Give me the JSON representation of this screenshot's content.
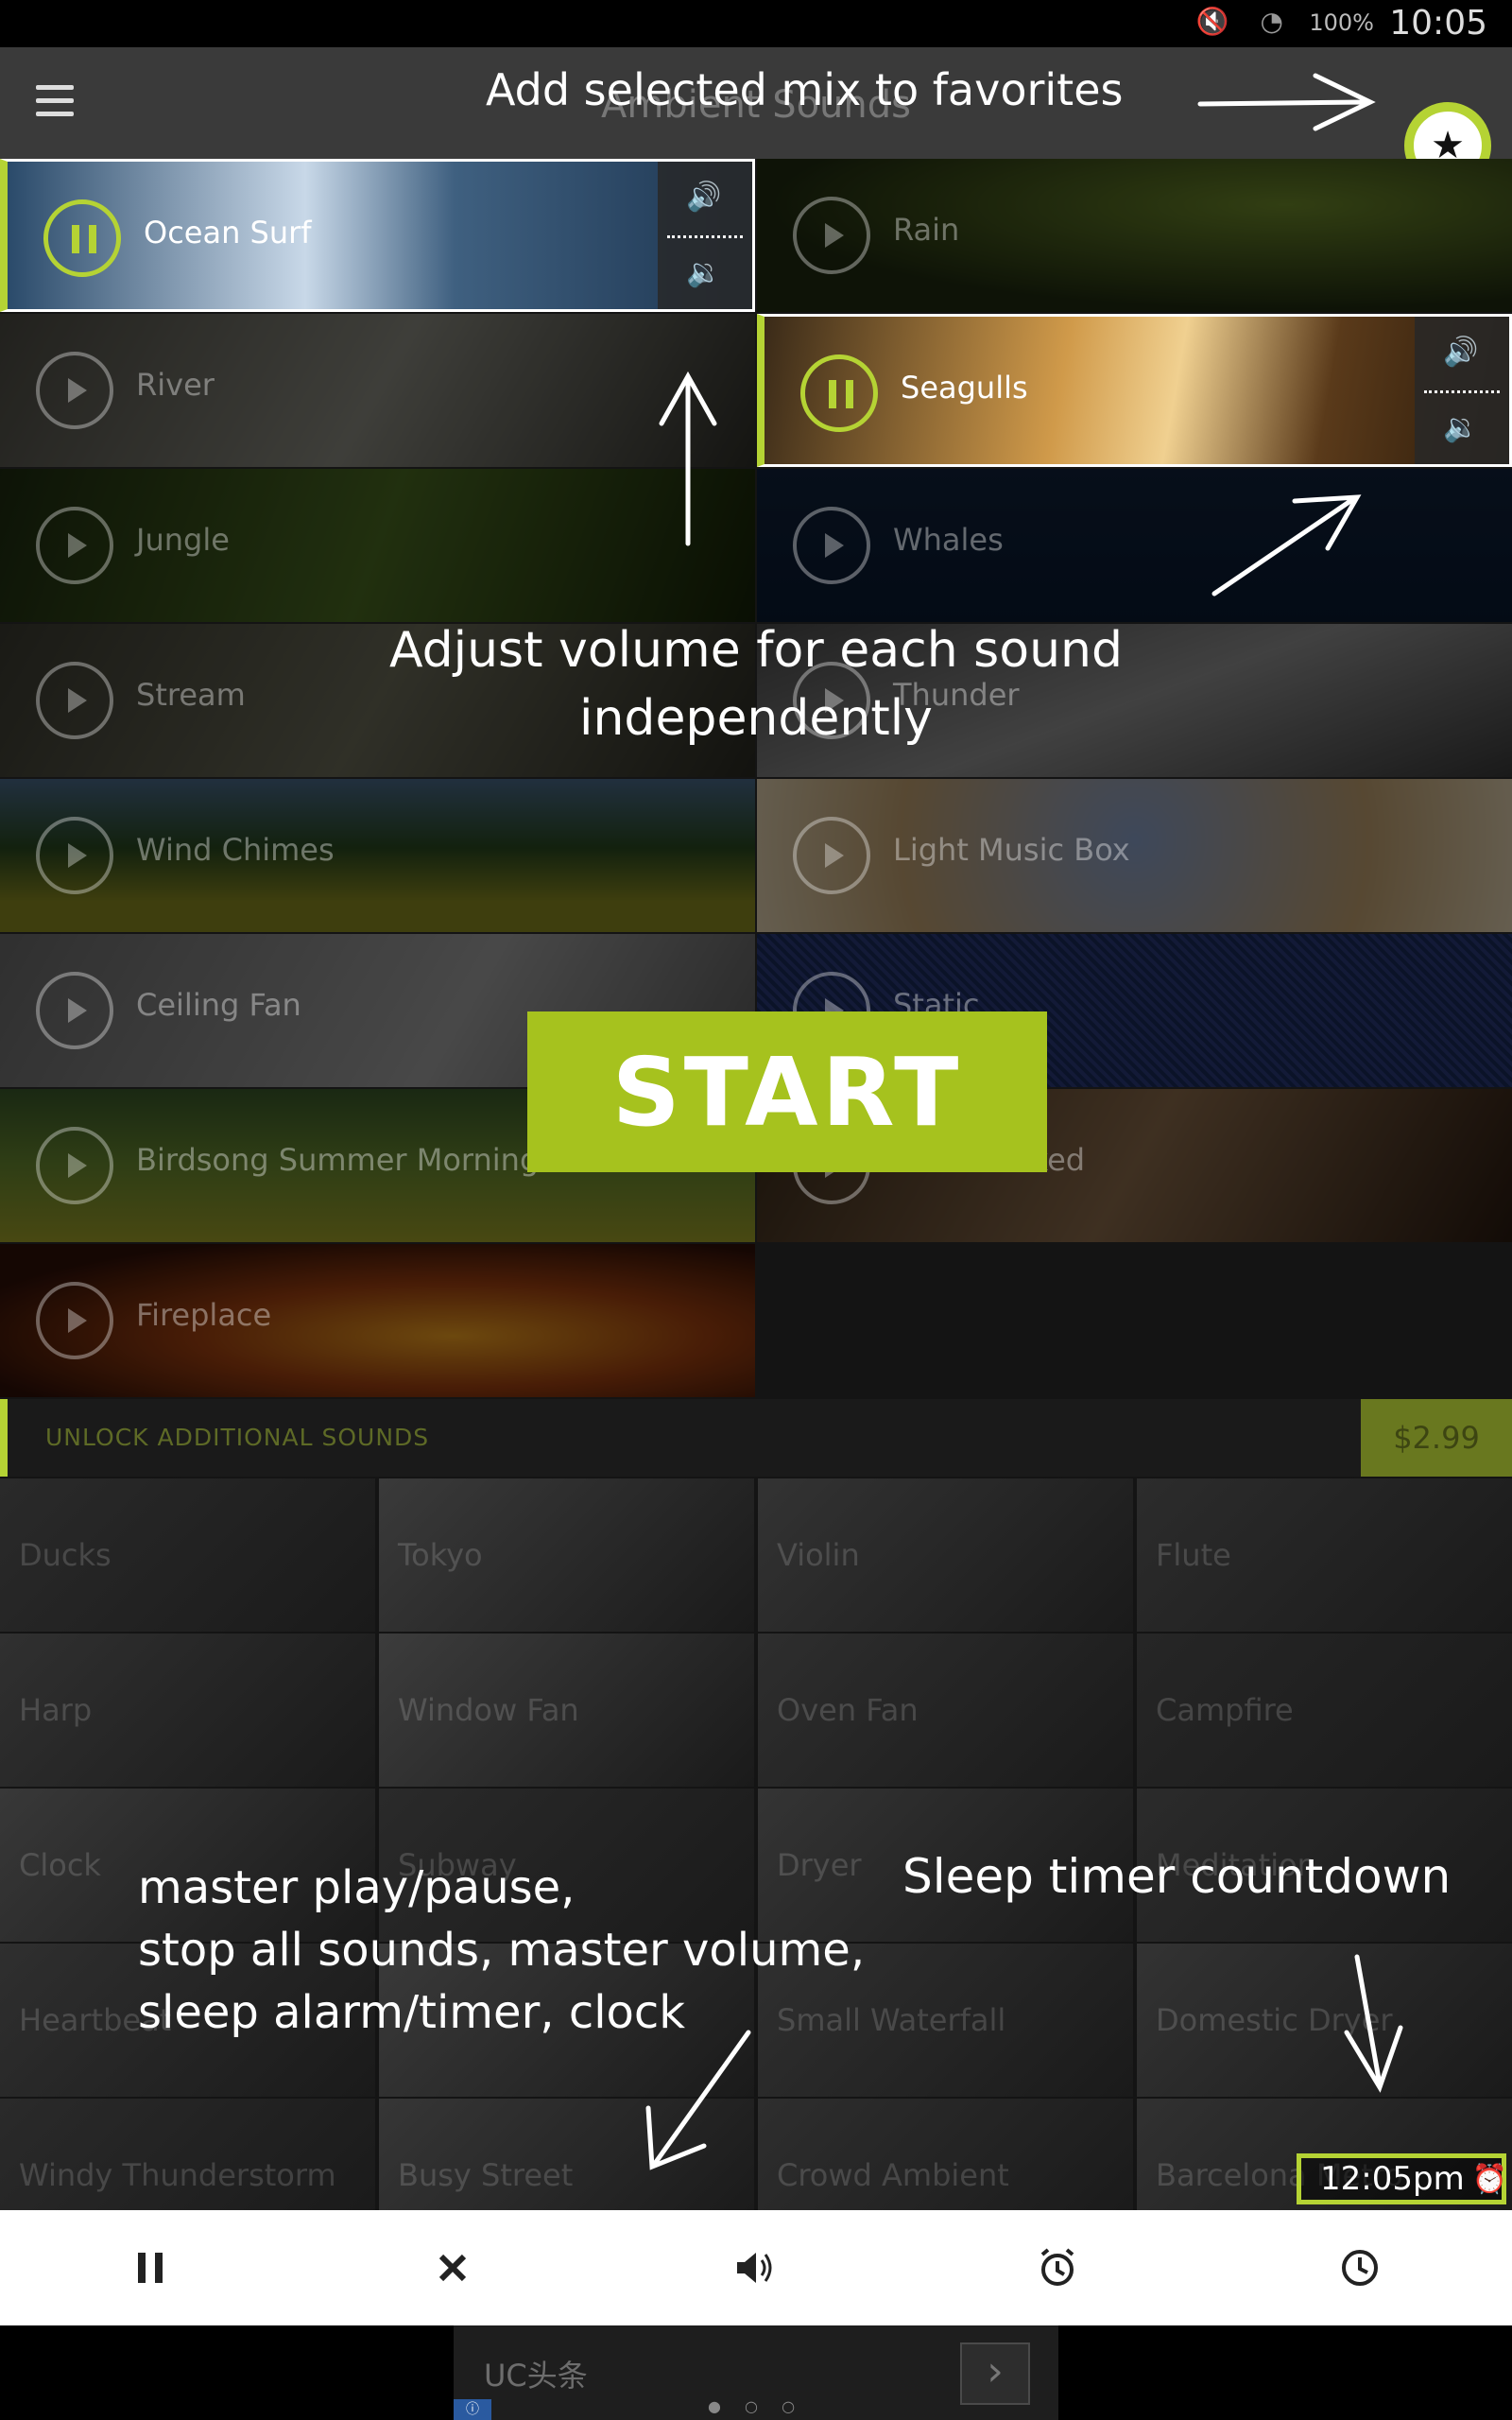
{
  "status_bar": {
    "battery": "100%",
    "time": "10:05"
  },
  "app_bar": {
    "title": "Ambient Sounds"
  },
  "sounds": [
    {
      "name": "Ocean Surf",
      "active": true
    },
    {
      "name": "Rain",
      "active": false
    },
    {
      "name": "River",
      "active": false
    },
    {
      "name": "Seagulls",
      "active": true
    },
    {
      "name": "Jungle",
      "active": false
    },
    {
      "name": "Whales",
      "active": false
    },
    {
      "name": "Stream",
      "active": false
    },
    {
      "name": "Thunder",
      "active": false
    },
    {
      "name": "Wind Chimes",
      "active": false
    },
    {
      "name": "Light Music Box",
      "active": false
    },
    {
      "name": "Ceiling Fan",
      "active": false
    },
    {
      "name": "Static",
      "active": false
    },
    {
      "name": "Birdsong Summer Morning",
      "active": false
    },
    {
      "name": "Boat Docked",
      "active": false
    },
    {
      "name": "Fireplace",
      "active": false
    }
  ],
  "unlock": {
    "label": "UNLOCK ADDITIONAL SOUNDS",
    "price": "$2.99"
  },
  "locked_sounds": [
    "Ducks",
    "Tokyo",
    "Violin",
    "Flute",
    "Harp",
    "Window Fan",
    "Oven Fan",
    "Campfire",
    "Clock",
    "Subway",
    "Dryer",
    "Meditation",
    "Heartbeat",
    "",
    "Small Waterfall",
    "Domestic Dryer",
    "Windy Thunderstorm",
    "Busy Street",
    "Crowd Ambient",
    "Barcelona Metro"
  ],
  "start_label": "START",
  "annotations": {
    "favorites": "Add selected mix to favorites",
    "volume_line1": "Adjust volume for each sound",
    "volume_line2": "independently",
    "master_line1": "master play/pause,",
    "master_line2": "stop all sounds, master volume,",
    "master_line3": "sleep alarm/timer, clock",
    "sleep": "Sleep timer countdown"
  },
  "timer": {
    "value": "12:05pm"
  },
  "toolbar": {
    "icons": [
      "pause-icon",
      "close-icon",
      "volume-icon",
      "alarm-icon",
      "clock-icon"
    ]
  },
  "ad": {
    "text": "UC头条",
    "arrow": "›"
  },
  "colors": {
    "accent": "#b5d334",
    "start": "#a6c21e"
  }
}
